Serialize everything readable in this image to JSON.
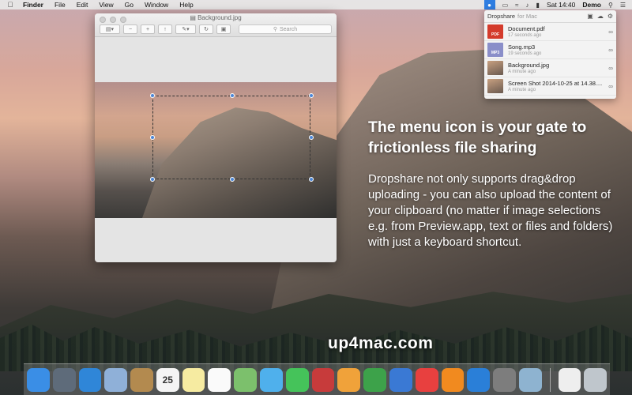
{
  "menubar": {
    "apple_icon": "apple-icon",
    "items": [
      "Finder",
      "File",
      "Edit",
      "View",
      "Go",
      "Window",
      "Help"
    ],
    "clock": "Sat 14:40",
    "user": "Demo"
  },
  "preview": {
    "title": "Background.jpg",
    "search_placeholder": "Search"
  },
  "dropshare": {
    "brand": "Dropshare",
    "subtitle": "for Mac",
    "items": [
      {
        "name": "Document.pdf",
        "time": "17 seconds ago",
        "thumb": "pdf",
        "label": "PDF"
      },
      {
        "name": "Song.mp3",
        "time": "19 seconds ago",
        "thumb": "mp3",
        "label": "MP3"
      },
      {
        "name": "Background.jpg",
        "time": "A minute ago",
        "thumb": "img",
        "label": ""
      },
      {
        "name": "Screen Shot 2014-10-25 at 14.38....",
        "time": "A minute ago",
        "thumb": "img",
        "label": ""
      }
    ]
  },
  "headline": "The menu icon is your gate to frictionless file sharing",
  "body": "Dropshare not only supports drag&drop uploading - you can also upload the content of your clipboard (no matter if image selections e.g. from Preview.app, text or files and folders) with just a keyboard shortcut.",
  "watermark": "up4mac.com",
  "dock": {
    "calendar_day": "25",
    "apps": [
      {
        "name": "finder-icon",
        "color": "#3a8ee6"
      },
      {
        "name": "launchpad-icon",
        "color": "#5e6b7a"
      },
      {
        "name": "safari-icon",
        "color": "#2f86d8"
      },
      {
        "name": "mail-icon",
        "color": "#8fb0d8"
      },
      {
        "name": "contacts-icon",
        "color": "#b38a4f"
      },
      {
        "name": "calendar-icon",
        "color": "#f4f4f4"
      },
      {
        "name": "notes-icon",
        "color": "#f6eba1"
      },
      {
        "name": "reminders-icon",
        "color": "#fafafa"
      },
      {
        "name": "maps-icon",
        "color": "#7cc06c"
      },
      {
        "name": "messages-icon",
        "color": "#4fb0ec"
      },
      {
        "name": "facetime-icon",
        "color": "#45c35a"
      },
      {
        "name": "photobooth-icon",
        "color": "#c73b3b"
      },
      {
        "name": "pages-icon",
        "color": "#f0a23a"
      },
      {
        "name": "numbers-icon",
        "color": "#3da24a"
      },
      {
        "name": "keynote-icon",
        "color": "#3a79d4"
      },
      {
        "name": "itunes-icon",
        "color": "#e8403f"
      },
      {
        "name": "ibooks-icon",
        "color": "#f18a1f"
      },
      {
        "name": "appstore-icon",
        "color": "#2a7fd8"
      },
      {
        "name": "systemprefs-icon",
        "color": "#7d7d7d"
      },
      {
        "name": "preview-icon",
        "color": "#8eb3d0"
      }
    ],
    "trailing": [
      {
        "name": "document-stack-icon",
        "color": "#eeeeee"
      },
      {
        "name": "trash-icon",
        "color": "#bfc6cc"
      }
    ]
  }
}
